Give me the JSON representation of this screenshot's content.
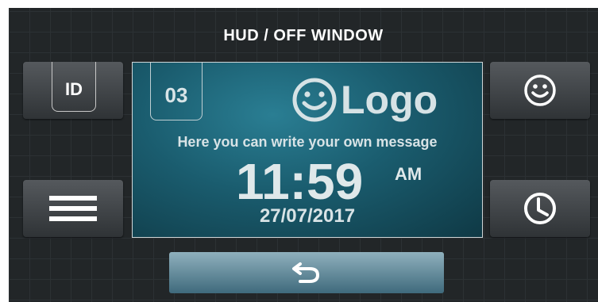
{
  "window": {
    "title": "HUD / OFF WINDOW"
  },
  "buttons": {
    "id_label": "ID",
    "left_bottom_icon": "hamburger-menu-icon",
    "right_top_icon": "smiley-icon",
    "right_bottom_icon": "clock-icon",
    "back_icon": "return-arrow-icon"
  },
  "panel": {
    "number": "03",
    "logo_text": "Logo",
    "message": "Here you can write your own message",
    "time": "11:59",
    "ampm": "AM",
    "date": "27/07/2017"
  },
  "colors": {
    "background": "#222628",
    "panel": "#1a5c6e",
    "button": "#44484c",
    "back_button": "#6f94a3"
  }
}
